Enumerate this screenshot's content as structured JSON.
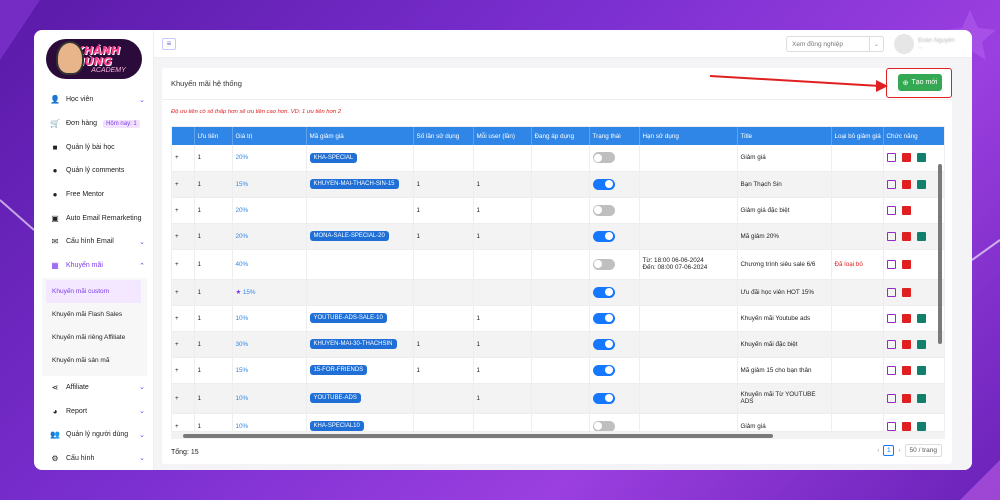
{
  "brand": {
    "name": "KHÁNH HÙNG",
    "sub": "ACADEMY"
  },
  "sidebar": {
    "items": [
      {
        "label": "Học viên",
        "icon": "user-graduate-icon",
        "chevron": true
      },
      {
        "label": "Đơn hàng",
        "icon": "cart-icon",
        "badge": "Hôm nay: 1"
      },
      {
        "label": "Quản lý bài học",
        "icon": "video-icon"
      },
      {
        "label": "Quản lý comments",
        "icon": "comments-icon"
      },
      {
        "label": "Free Mentor",
        "icon": "person-icon"
      },
      {
        "label": "Auto Email Remarketing",
        "icon": "email-icon"
      },
      {
        "label": "Cấu hình Email",
        "icon": "envelope-icon",
        "chevron": true
      },
      {
        "label": "Khuyến mãi",
        "icon": "promo-icon",
        "chevron": true
      }
    ],
    "submenu": [
      "Khuyến mãi custom",
      "Khuyến mãi Flash Sales",
      "Khuyến mãi riêng Affiliate",
      "Khuyến mãi sản mã"
    ],
    "bottom_items": [
      {
        "label": "Affiliate",
        "icon": "share-icon"
      },
      {
        "label": "Report",
        "icon": "chart-pie-icon"
      },
      {
        "label": "Quản lý người dùng",
        "icon": "users-icon"
      },
      {
        "label": "Cấu hình",
        "icon": "gear-icon"
      }
    ]
  },
  "topbar": {
    "colleague_placeholder": "Xem đồng nghiệp",
    "user_name": "Đoàn Nguyễn"
  },
  "card": {
    "title": "Khuyến mãi hệ thống",
    "create_button": "Tạo mới",
    "note": "Độ ưu tiên có số thấp hơn sẽ ưu tiên cao hơn. VD: 1 ưu tiên hơn 2"
  },
  "table": {
    "headers": [
      "",
      "Ưu tiên",
      "Giá trị",
      "Mã giảm giá",
      "Số lần sử dụng",
      "Mỗi user (lần)",
      "Đang áp dụng",
      "Trạng thái",
      "Hạn sử dụng",
      "Title",
      "Loại bỏ giảm giá",
      "Chức năng"
    ],
    "rows": [
      {
        "priority": "1",
        "value": "20%",
        "code": "KHA-SPECIAL",
        "uses": "",
        "per_user": "",
        "status": "off",
        "expiry": "",
        "title": "Giảm giá",
        "exclude": "",
        "copy": true
      },
      {
        "priority": "1",
        "value": "15%",
        "code": "KHUYEN-MAI-THACH-SIN-15",
        "uses": "1",
        "per_user": "1",
        "status": "on",
        "expiry": "",
        "title": "Bạn Thạch Sin",
        "exclude": "",
        "copy": true
      },
      {
        "priority": "1",
        "value": "20%",
        "code": "",
        "uses": "1",
        "per_user": "1",
        "status": "off",
        "expiry": "",
        "title": "Giảm giá đặc biệt",
        "exclude": "",
        "copy": false
      },
      {
        "priority": "1",
        "value": "20%",
        "code": "MONA-SALE-SPECIAL-20",
        "uses": "1",
        "per_user": "1",
        "status": "on",
        "expiry": "",
        "title": "Mã giảm 20%",
        "exclude": "",
        "copy": true
      },
      {
        "priority": "1",
        "value": "40%",
        "code": "",
        "uses": "",
        "per_user": "",
        "status": "off",
        "expiry": "Từ: 18:00 06-06-2024\nĐến: 08:00 07-06-2024",
        "title": "Chương trình siêu sale 6/6",
        "exclude": "Đã loại bỏ",
        "copy": false
      },
      {
        "priority": "1",
        "value": "15%",
        "star": true,
        "code": "",
        "uses": "",
        "per_user": "",
        "status": "on",
        "expiry": "",
        "title": "Ưu đãi học viên HOT 15%",
        "exclude": "",
        "copy": false
      },
      {
        "priority": "1",
        "value": "10%",
        "code": "YOUTUBE-ADS-SALE-10",
        "uses": "",
        "per_user": "1",
        "status": "on",
        "expiry": "",
        "title": "Khuyến mãi Youtube ads",
        "exclude": "",
        "copy": true
      },
      {
        "priority": "1",
        "value": "30%",
        "code": "KHUYEN-MAI-30-THACHSIN",
        "uses": "1",
        "per_user": "1",
        "status": "on",
        "expiry": "",
        "title": "Khuyến mãi đặc biệt",
        "exclude": "",
        "copy": true
      },
      {
        "priority": "1",
        "value": "15%",
        "code": "15-FOR-FRIENDS",
        "uses": "1",
        "per_user": "1",
        "status": "on",
        "expiry": "",
        "title": "Mã giảm 15 cho bạn thân",
        "exclude": "",
        "copy": true
      },
      {
        "priority": "1",
        "value": "10%",
        "code": "YOUTUBE-ADS",
        "uses": "",
        "per_user": "1",
        "status": "on",
        "expiry": "",
        "title": "Khuyến mãi Từ YOUTUBE ADS",
        "exclude": "",
        "copy": true
      },
      {
        "priority": "1",
        "value": "10%",
        "code": "KHA-SPECIAL10",
        "uses": "",
        "per_user": "",
        "status": "off",
        "expiry": "",
        "title": "Giảm giá",
        "exclude": "",
        "copy": true
      }
    ]
  },
  "footer": {
    "total": "Tổng: 15",
    "page": "1",
    "page_size": "50 / trang"
  },
  "colors": {
    "accent": "#7c3aed",
    "header": "#2f86e6",
    "create": "#34a853",
    "annotation": "#e02020"
  }
}
